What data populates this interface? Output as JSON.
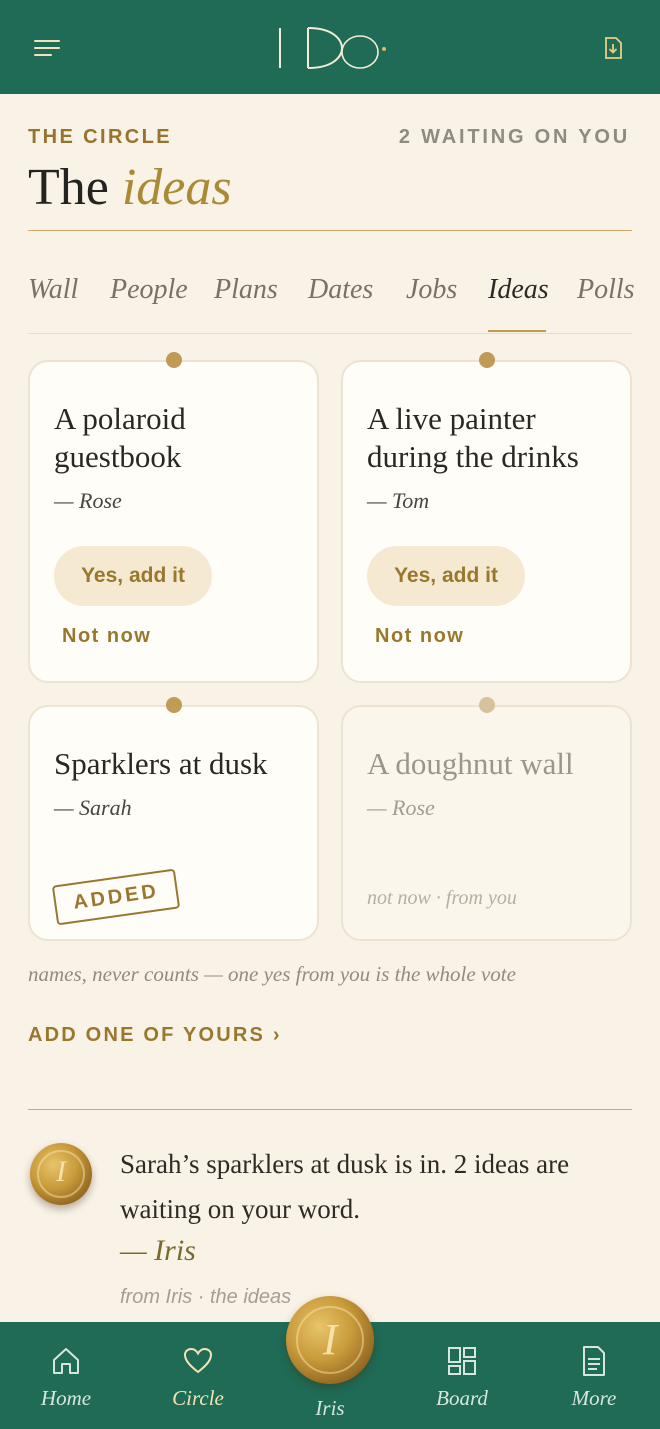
{
  "app": {
    "logo_text": "I Do"
  },
  "header": {
    "eyebrow": "THE CIRCLE",
    "waiting": "2 WAITING ON YOU",
    "title_plain": "The",
    "title_italic": "ideas"
  },
  "tabs": [
    {
      "label": "Wall"
    },
    {
      "label": "People"
    },
    {
      "label": "Plans"
    },
    {
      "label": "Dates"
    },
    {
      "label": "Jobs"
    },
    {
      "label": "Ideas",
      "active": true
    },
    {
      "label": "Polls"
    }
  ],
  "cards": [
    {
      "title": "A polaroid guestbook",
      "author": "— Rose",
      "yes_label": "Yes, add it",
      "no_label": "Not now"
    },
    {
      "title": "A live painter during the drinks",
      "author": "— Tom",
      "yes_label": "Yes, add it",
      "no_label": "Not now"
    },
    {
      "title": "Sparklers at dusk",
      "author": "— Sarah",
      "stamp": "ADDED"
    },
    {
      "title": "A doughnut wall",
      "author": "— Rose",
      "note": "not now · from you"
    }
  ],
  "footnote": "names, never counts — one yes from you is the whole vote",
  "add_link": "ADD ONE OF YOURS ›",
  "iris": {
    "seal_glyph": "I",
    "message": "Sarah’s sparklers at dusk is in. 2 ideas are waiting on your word.",
    "signature": "— Iris",
    "source": "from Iris · the ideas"
  },
  "nav": [
    {
      "label": "Home",
      "icon": "home-icon"
    },
    {
      "label": "Circle",
      "icon": "heart-icon",
      "active": true
    },
    {
      "label": "Iris",
      "icon": "wax-seal-icon"
    },
    {
      "label": "Board",
      "icon": "grid-icon"
    },
    {
      "label": "More",
      "icon": "document-icon"
    }
  ],
  "colors": {
    "brand_green": "#1f6b55",
    "gold": "#98782d",
    "paper": "#f8f2e7"
  }
}
